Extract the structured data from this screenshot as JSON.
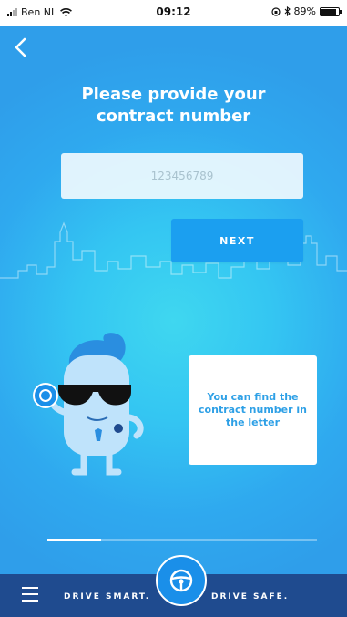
{
  "status_bar": {
    "carrier": "Ben NL",
    "time": "09:12",
    "battery": "89%",
    "battery_level": 0.89,
    "icons": [
      "signal-icon",
      "wifi-icon",
      "lock-rotation-icon",
      "bluetooth-icon",
      "battery-icon"
    ]
  },
  "nav": {
    "back_icon": "chevron-left-icon"
  },
  "form": {
    "title_line1": "Please provide your",
    "title_line2": "contract number",
    "contract_placeholder": "123456789",
    "next_label": "NEXT"
  },
  "hint": {
    "line1": "You can find the",
    "line2": "contract number in",
    "line3": "the letter"
  },
  "progress": {
    "fraction": 0.2
  },
  "bottom_bar": {
    "menu_icon": "hamburger-menu-icon",
    "slogan_left": "DRIVE SMART.",
    "slogan_right": "DRIVE SAFE.",
    "center_icon": "steering-wheel-icon"
  },
  "colors": {
    "background": "#34c6f2",
    "accent_button": "#1b9ff0",
    "bottom_bar": "#1f4b8f",
    "hint_text": "#2ea0e6"
  }
}
